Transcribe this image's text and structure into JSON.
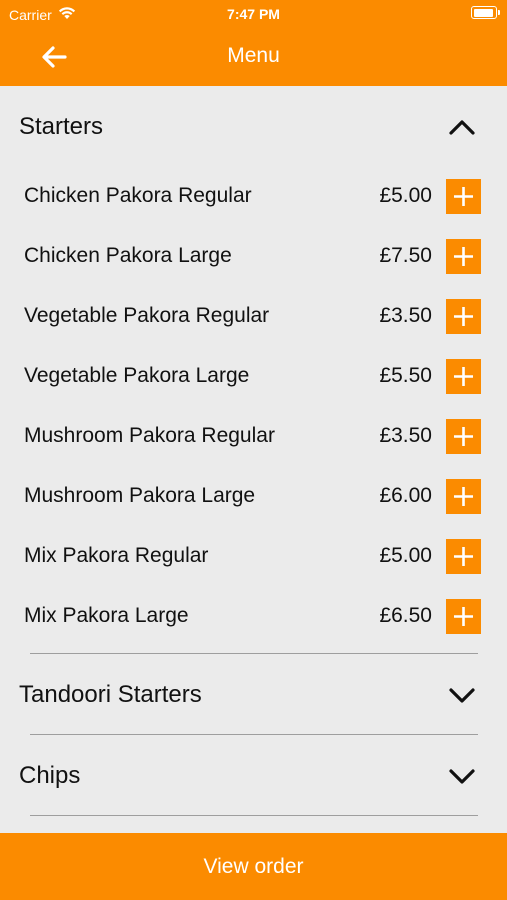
{
  "status_bar": {
    "carrier": "Carrier",
    "time": "7:47 PM"
  },
  "nav": {
    "title": "Menu"
  },
  "sections": [
    {
      "title": "Starters",
      "expanded": true,
      "items": [
        {
          "name": "Chicken Pakora Regular",
          "price": "£5.00"
        },
        {
          "name": "Chicken Pakora Large",
          "price": "£7.50"
        },
        {
          "name": "Vegetable Pakora Regular",
          "price": "£3.50"
        },
        {
          "name": "Vegetable Pakora Large",
          "price": "£5.50"
        },
        {
          "name": "Mushroom Pakora Regular",
          "price": "£3.50"
        },
        {
          "name": "Mushroom Pakora Large",
          "price": "£6.00"
        },
        {
          "name": "Mix Pakora Regular",
          "price": "£5.00"
        },
        {
          "name": "Mix Pakora Large",
          "price": "£6.50"
        }
      ]
    },
    {
      "title": "Tandoori Starters",
      "expanded": false
    },
    {
      "title": "Chips",
      "expanded": false
    }
  ],
  "footer": {
    "view_order_label": "View order"
  },
  "colors": {
    "accent": "#fb8b00",
    "background": "#ebebeb",
    "divider": "#9e9e9e"
  }
}
